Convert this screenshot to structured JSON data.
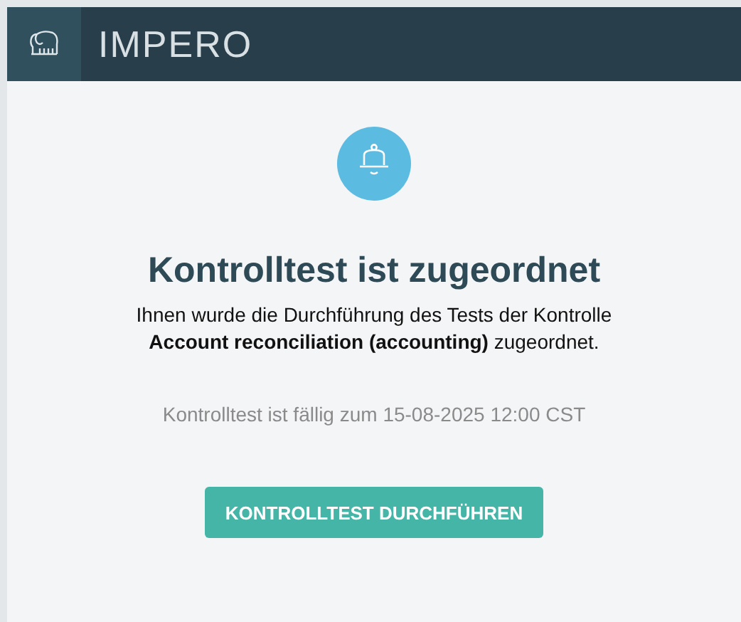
{
  "header": {
    "brand": "IMPERO"
  },
  "notification": {
    "title": "Kontrolltest ist zugeordnet",
    "message": "Ihnen wurde die Durchführung des Tests der Kontrolle **Account reconciliation (accounting)** zugeordnet.",
    "due": "Kontrolltest ist fällig zum 15-08-2025 12:00 CST",
    "button": "KONTROLLTEST DURCHFÜHREN"
  }
}
